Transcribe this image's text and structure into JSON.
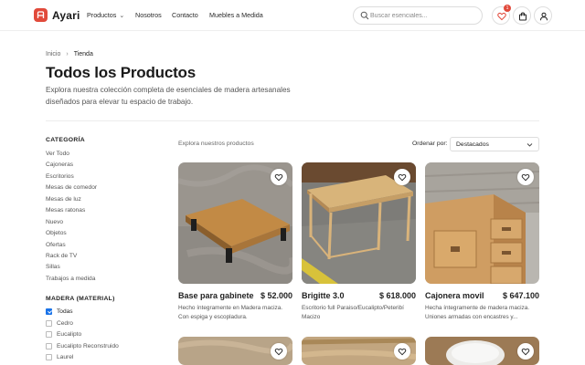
{
  "header": {
    "brand": "Ayari",
    "nav": [
      {
        "label": "Productos",
        "has_dropdown": true
      },
      {
        "label": "Nosotros"
      },
      {
        "label": "Contacto"
      },
      {
        "label": "Muebles a Medida"
      }
    ],
    "search_placeholder": "Buscar esenciales...",
    "wishlist_count": "1",
    "accent_color": "#e14a3b"
  },
  "breadcrumb": {
    "home": "Inicio",
    "current": "Tienda"
  },
  "page": {
    "title": "Todos los Productos",
    "description": "Explora nuestra colección completa de esenciales de madera artesanales diseñados para elevar tu espacio de trabajo."
  },
  "sidebar": {
    "category_heading": "CATEGORÍA",
    "categories": [
      "Ver Todo",
      "Cajoneras",
      "Escritorios",
      "Mesas de comedor",
      "Mesas de luz",
      "Mesas ratonas",
      "Nuevo",
      "Objetos",
      "Ofertas",
      "Rack de TV",
      "Sillas",
      "Trabajos a medida"
    ],
    "material_heading": "MADERA (MATERIAL)",
    "materials": [
      {
        "label": "Todas",
        "checked": true
      },
      {
        "label": "Cedro",
        "checked": false
      },
      {
        "label": "Eucalipto",
        "checked": false
      },
      {
        "label": "Eucalipto Reconstruido",
        "checked": false
      },
      {
        "label": "Laurel",
        "checked": false
      }
    ]
  },
  "toolbar": {
    "explore_label": "Explora nuestros productos",
    "sort_label": "Ordenar por:",
    "sort_value": "Destacados"
  },
  "products": [
    {
      "name": "Base para gabinete",
      "price": "$ 52.000",
      "description": "Hecho íntegramente en Madera maciza. Con espiga y escopladura."
    },
    {
      "name": "Brigitte 3.0",
      "price": "$ 618.000",
      "description": "Escritorio full Paraiso/Eucalipto/Peteribí Macizo"
    },
    {
      "name": "Cajonera movil",
      "price": "$ 647.100",
      "description": "Hecha íntegramente de madera maciza. Uniones armadas con encastres y..."
    }
  ]
}
